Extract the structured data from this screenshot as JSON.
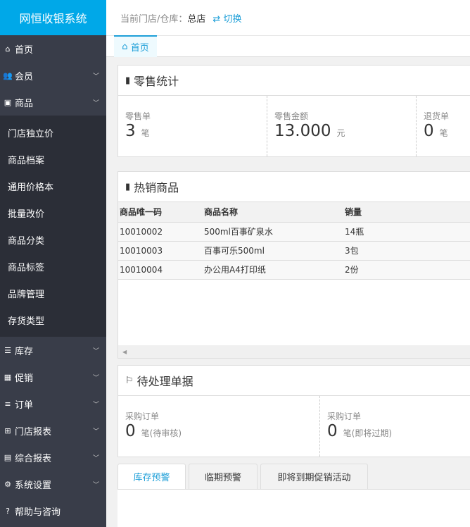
{
  "app_title": "网恒收银系统",
  "topbar": {
    "store_label": "当前门店/仓库：",
    "store": "总店",
    "switch": "切换"
  },
  "tab": "首页",
  "sidebar": {
    "items_top": [
      {
        "icon": "home-icon",
        "label": "首页"
      },
      {
        "icon": "users-icon",
        "label": "会员"
      },
      {
        "icon": "image-icon",
        "label": "商品"
      }
    ],
    "sub": [
      "门店独立价",
      "商品档案",
      "通用价格本",
      "批量改价",
      "商品分类",
      "商品标签",
      "品牌管理",
      "存货类型"
    ],
    "items_bottom": [
      {
        "icon": "database-icon",
        "label": "库存"
      },
      {
        "icon": "gift-icon",
        "label": "促销"
      },
      {
        "icon": "list-icon",
        "label": "订单"
      },
      {
        "icon": "table-icon",
        "label": "门店报表"
      },
      {
        "icon": "grid-icon",
        "label": "综合报表"
      },
      {
        "icon": "gear-icon",
        "label": "系统设置"
      },
      {
        "icon": "question-icon",
        "label": "帮助与咨询"
      }
    ]
  },
  "retail": {
    "title": "零售统计",
    "stats": [
      {
        "label": "零售单",
        "value": "3",
        "unit": "笔"
      },
      {
        "label": "零售金额",
        "value": "13.000",
        "unit": "元"
      },
      {
        "label": "退货单",
        "value": "0",
        "unit": "笔"
      }
    ]
  },
  "hot": {
    "title": "热销商品",
    "headers": [
      "商品唯一码",
      "商品名称",
      "销量"
    ],
    "rows": [
      [
        "10010002",
        "500ml百事矿泉水",
        "14瓶"
      ],
      [
        "10010003",
        "百事可乐500ml",
        "3包"
      ],
      [
        "10010004",
        "办公用A4打印纸",
        "2份"
      ]
    ]
  },
  "pending": {
    "title": "待处理单据",
    "stats": [
      {
        "label": "采购订单",
        "value": "0",
        "unit": "笔(待审核)"
      },
      {
        "label": "采购订单",
        "value": "0",
        "unit": "笔(即将过期)"
      }
    ]
  },
  "bottom_tabs": [
    "库存预警",
    "临期预警",
    "即将到期促销活动"
  ]
}
